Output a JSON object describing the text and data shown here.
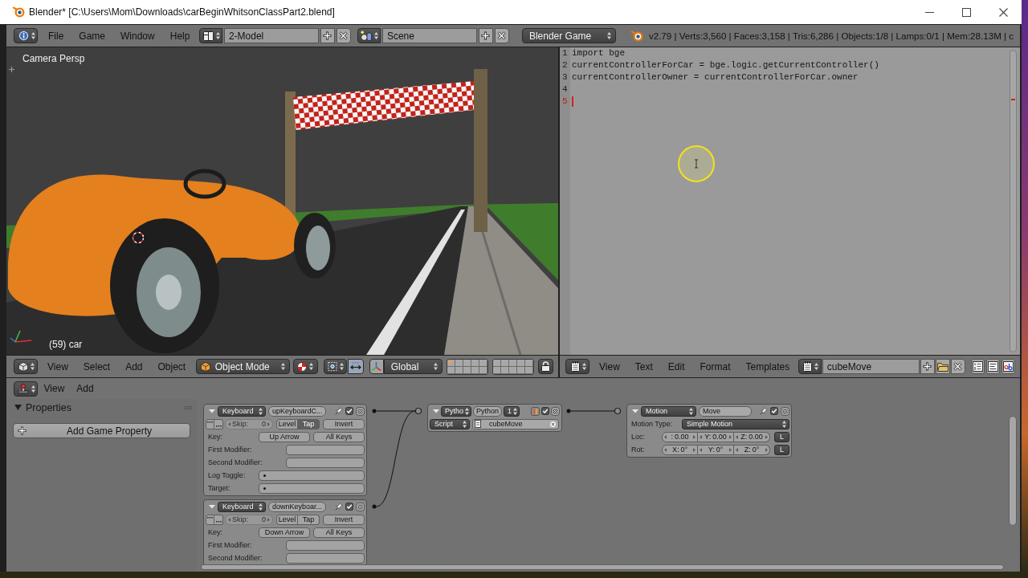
{
  "window": {
    "title": "Blender* [C:\\Users\\Mom\\Downloads\\carBeginWhitsonClassPart2.blend]"
  },
  "info_header": {
    "menus": [
      "File",
      "Game",
      "Window",
      "Help"
    ],
    "screen_layout": "2-Model",
    "scene": "Scene",
    "engine": "Blender Game",
    "stats": "v2.79 | Verts:3,560 | Faces:3,158 | Tris:6,286 | Objects:1/8 | Lamps:0/1 | Mem:28.13M | c"
  },
  "viewport": {
    "view_name": "Camera Persp",
    "object_info": "(59) car"
  },
  "text_editor": {
    "lines": [
      {
        "number": "1",
        "code": "import bge",
        "current": false
      },
      {
        "number": "2",
        "code": "currentControllerForCar = bge.logic.getCurrentController()",
        "current": false
      },
      {
        "number": "3",
        "code": "currentControllerOwner = currentControllerForCar.owner",
        "current": false
      },
      {
        "number": "4",
        "current": false
      },
      {
        "number": "5",
        "current": true
      }
    ]
  },
  "viewport_header": {
    "menus": [
      "View",
      "Select",
      "Add",
      "Object"
    ],
    "mode": "Object Mode",
    "orientation": "Global",
    "layers": [
      {
        "object": true
      },
      {
        "object": false
      },
      {
        "object": false
      },
      {
        "object": false
      },
      {
        "object": false
      },
      {
        "object": false
      },
      {
        "object": false
      },
      {
        "object": false
      },
      {
        "object": false
      },
      {
        "object": false
      },
      {
        "object": false
      },
      {
        "object": false
      },
      {
        "object": false
      },
      {
        "object": false
      },
      {
        "object": false
      },
      {
        "object": false
      },
      {
        "object": false
      },
      {
        "object": false
      },
      {
        "object": false
      },
      {
        "object": false
      }
    ]
  },
  "text_header": {
    "menus": [
      "View",
      "Text",
      "Edit",
      "Format",
      "Templates"
    ],
    "text_name": "cubeMove"
  },
  "logic_editor": {
    "menus": [
      "View",
      "Add"
    ],
    "properties_panel": {
      "title": "Properties",
      "expanded": true,
      "button": "Add Game Property"
    },
    "sensors": [
      {
        "expanded": true,
        "type": "Keyboard",
        "name": "upKeyboardC...",
        "active": true,
        "skip": {
          "label": "Skip:",
          "value": "0",
          "disabled": true
        },
        "level": {
          "label": "Level",
          "selected": false
        },
        "tap": {
          "label": "Tap",
          "selected": true
        },
        "invert": {
          "label": "Invert",
          "selected": false
        },
        "fields": [
          {
            "kind": "key",
            "label": "Key:",
            "values": [
              "Up Arrow",
              "All Keys"
            ]
          },
          {
            "kind": "modifier",
            "label": "First Modifier:"
          },
          {
            "kind": "modifier",
            "label": "Second Modifier:"
          },
          {
            "kind": "property",
            "label": "Log Toggle:"
          },
          {
            "kind": "property",
            "label": "Target:"
          }
        ]
      },
      {
        "expanded": true,
        "type": "Keyboard",
        "name": "downKeyboar...",
        "active": true,
        "skip": {
          "label": "Skip:",
          "value": "0",
          "disabled": true
        },
        "level": {
          "label": "Level",
          "selected": false
        },
        "tap": {
          "label": "Tap",
          "selected": false
        },
        "invert": {
          "label": "Invert",
          "selected": false
        },
        "fields": [
          {
            "kind": "key",
            "label": "Key:",
            "values": [
              "Down Arrow",
              "All Keys"
            ]
          },
          {
            "kind": "modifier",
            "label": "First Modifier:"
          },
          {
            "kind": "modifier",
            "label": "Second Modifier:"
          }
        ]
      }
    ],
    "controllers": [
      {
        "expanded": true,
        "type": "Pytho",
        "name": "Python",
        "state": "1",
        "active": true,
        "mode": "Script",
        "script": "cubeMove"
      }
    ],
    "actuators": [
      {
        "expanded": true,
        "type": "Motion",
        "name": "Move",
        "active": true,
        "motion_type_label": "Motion Type:",
        "motion_type": "Simple Motion",
        "rows": [
          {
            "label": "Loc:",
            "fields": [
              {
                "axis": ":",
                "value": "0.00"
              },
              {
                "axis": "Y:",
                "value": "0.00"
              },
              {
                "axis": "Z:",
                "value": "0.00"
              }
            ],
            "local": "L"
          },
          {
            "label": "Rot:",
            "fields": [
              {
                "axis": "X:",
                "value": "0°"
              },
              {
                "axis": "Y:",
                "value": "0°"
              },
              {
                "axis": "Z:",
                "value": "0°"
              }
            ],
            "local": "L"
          }
        ]
      }
    ]
  }
}
